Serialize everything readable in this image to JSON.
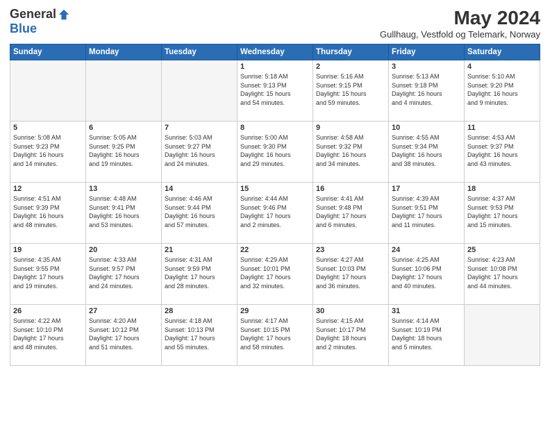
{
  "header": {
    "logo_general": "General",
    "logo_blue": "Blue",
    "month_year": "May 2024",
    "location": "Gullhaug, Vestfold og Telemark, Norway"
  },
  "days_of_week": [
    "Sunday",
    "Monday",
    "Tuesday",
    "Wednesday",
    "Thursday",
    "Friday",
    "Saturday"
  ],
  "weeks": [
    [
      {
        "day": "",
        "content": ""
      },
      {
        "day": "",
        "content": ""
      },
      {
        "day": "",
        "content": ""
      },
      {
        "day": "1",
        "content": "Sunrise: 5:18 AM\nSunset: 9:13 PM\nDaylight: 15 hours\nand 54 minutes."
      },
      {
        "day": "2",
        "content": "Sunrise: 5:16 AM\nSunset: 9:15 PM\nDaylight: 15 hours\nand 59 minutes."
      },
      {
        "day": "3",
        "content": "Sunrise: 5:13 AM\nSunset: 9:18 PM\nDaylight: 16 hours\nand 4 minutes."
      },
      {
        "day": "4",
        "content": "Sunrise: 5:10 AM\nSunset: 9:20 PM\nDaylight: 16 hours\nand 9 minutes."
      }
    ],
    [
      {
        "day": "5",
        "content": "Sunrise: 5:08 AM\nSunset: 9:23 PM\nDaylight: 16 hours\nand 14 minutes."
      },
      {
        "day": "6",
        "content": "Sunrise: 5:05 AM\nSunset: 9:25 PM\nDaylight: 16 hours\nand 19 minutes."
      },
      {
        "day": "7",
        "content": "Sunrise: 5:03 AM\nSunset: 9:27 PM\nDaylight: 16 hours\nand 24 minutes."
      },
      {
        "day": "8",
        "content": "Sunrise: 5:00 AM\nSunset: 9:30 PM\nDaylight: 16 hours\nand 29 minutes."
      },
      {
        "day": "9",
        "content": "Sunrise: 4:58 AM\nSunset: 9:32 PM\nDaylight: 16 hours\nand 34 minutes."
      },
      {
        "day": "10",
        "content": "Sunrise: 4:55 AM\nSunset: 9:34 PM\nDaylight: 16 hours\nand 38 minutes."
      },
      {
        "day": "11",
        "content": "Sunrise: 4:53 AM\nSunset: 9:37 PM\nDaylight: 16 hours\nand 43 minutes."
      }
    ],
    [
      {
        "day": "12",
        "content": "Sunrise: 4:51 AM\nSunset: 9:39 PM\nDaylight: 16 hours\nand 48 minutes."
      },
      {
        "day": "13",
        "content": "Sunrise: 4:48 AM\nSunset: 9:41 PM\nDaylight: 16 hours\nand 53 minutes."
      },
      {
        "day": "14",
        "content": "Sunrise: 4:46 AM\nSunset: 9:44 PM\nDaylight: 16 hours\nand 57 minutes."
      },
      {
        "day": "15",
        "content": "Sunrise: 4:44 AM\nSunset: 9:46 PM\nDaylight: 17 hours\nand 2 minutes."
      },
      {
        "day": "16",
        "content": "Sunrise: 4:41 AM\nSunset: 9:48 PM\nDaylight: 17 hours\nand 6 minutes."
      },
      {
        "day": "17",
        "content": "Sunrise: 4:39 AM\nSunset: 9:51 PM\nDaylight: 17 hours\nand 11 minutes."
      },
      {
        "day": "18",
        "content": "Sunrise: 4:37 AM\nSunset: 9:53 PM\nDaylight: 17 hours\nand 15 minutes."
      }
    ],
    [
      {
        "day": "19",
        "content": "Sunrise: 4:35 AM\nSunset: 9:55 PM\nDaylight: 17 hours\nand 19 minutes."
      },
      {
        "day": "20",
        "content": "Sunrise: 4:33 AM\nSunset: 9:57 PM\nDaylight: 17 hours\nand 24 minutes."
      },
      {
        "day": "21",
        "content": "Sunrise: 4:31 AM\nSunset: 9:59 PM\nDaylight: 17 hours\nand 28 minutes."
      },
      {
        "day": "22",
        "content": "Sunrise: 4:29 AM\nSunset: 10:01 PM\nDaylight: 17 hours\nand 32 minutes."
      },
      {
        "day": "23",
        "content": "Sunrise: 4:27 AM\nSunset: 10:03 PM\nDaylight: 17 hours\nand 36 minutes."
      },
      {
        "day": "24",
        "content": "Sunrise: 4:25 AM\nSunset: 10:06 PM\nDaylight: 17 hours\nand 40 minutes."
      },
      {
        "day": "25",
        "content": "Sunrise: 4:23 AM\nSunset: 10:08 PM\nDaylight: 17 hours\nand 44 minutes."
      }
    ],
    [
      {
        "day": "26",
        "content": "Sunrise: 4:22 AM\nSunset: 10:10 PM\nDaylight: 17 hours\nand 48 minutes."
      },
      {
        "day": "27",
        "content": "Sunrise: 4:20 AM\nSunset: 10:12 PM\nDaylight: 17 hours\nand 51 minutes."
      },
      {
        "day": "28",
        "content": "Sunrise: 4:18 AM\nSunset: 10:13 PM\nDaylight: 17 hours\nand 55 minutes."
      },
      {
        "day": "29",
        "content": "Sunrise: 4:17 AM\nSunset: 10:15 PM\nDaylight: 17 hours\nand 58 minutes."
      },
      {
        "day": "30",
        "content": "Sunrise: 4:15 AM\nSunset: 10:17 PM\nDaylight: 18 hours\nand 2 minutes."
      },
      {
        "day": "31",
        "content": "Sunrise: 4:14 AM\nSunset: 10:19 PM\nDaylight: 18 hours\nand 5 minutes."
      },
      {
        "day": "",
        "content": ""
      }
    ]
  ]
}
